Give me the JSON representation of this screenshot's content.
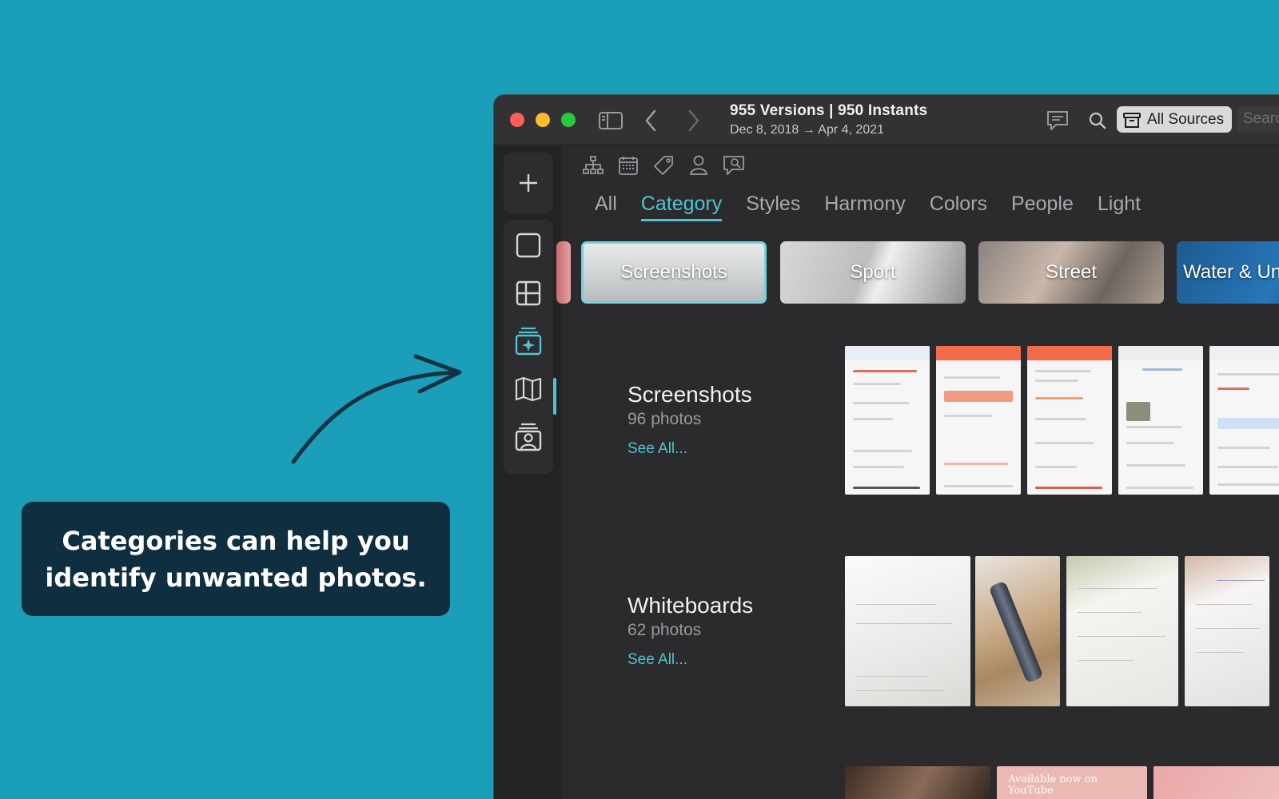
{
  "callout": {
    "line1": "Categories can help you",
    "line2": "identify unwanted photos."
  },
  "window": {
    "title": "955 Versions | 950 Instants",
    "subtitle": "Dec 8, 2018 → Apr 4, 2021",
    "sources_label": "All Sources",
    "search_placeholder": "Search"
  },
  "tabs": [
    {
      "label": "All",
      "active": false
    },
    {
      "label": "Category",
      "active": true
    },
    {
      "label": "Styles",
      "active": false
    },
    {
      "label": "Harmony",
      "active": false
    },
    {
      "label": "Colors",
      "active": false
    },
    {
      "label": "People",
      "active": false
    },
    {
      "label": "Light",
      "active": false
    }
  ],
  "categories": [
    {
      "label": "Screenshots",
      "selected": true
    },
    {
      "label": "Sport",
      "selected": false
    },
    {
      "label": "Street",
      "selected": false
    },
    {
      "label": "Water & Un",
      "selected": false
    }
  ],
  "sections": [
    {
      "title": "Screenshots",
      "count": "96 photos",
      "link": "See All..."
    },
    {
      "title": "Whiteboards",
      "count": "62 photos",
      "link": "See All..."
    }
  ],
  "thumb_text": {
    "youtube": "Available now on YouTube"
  },
  "colors": {
    "accent": "#4fc3d4",
    "background": "#1b9eb7",
    "callout_bg": "#0f2f40"
  }
}
